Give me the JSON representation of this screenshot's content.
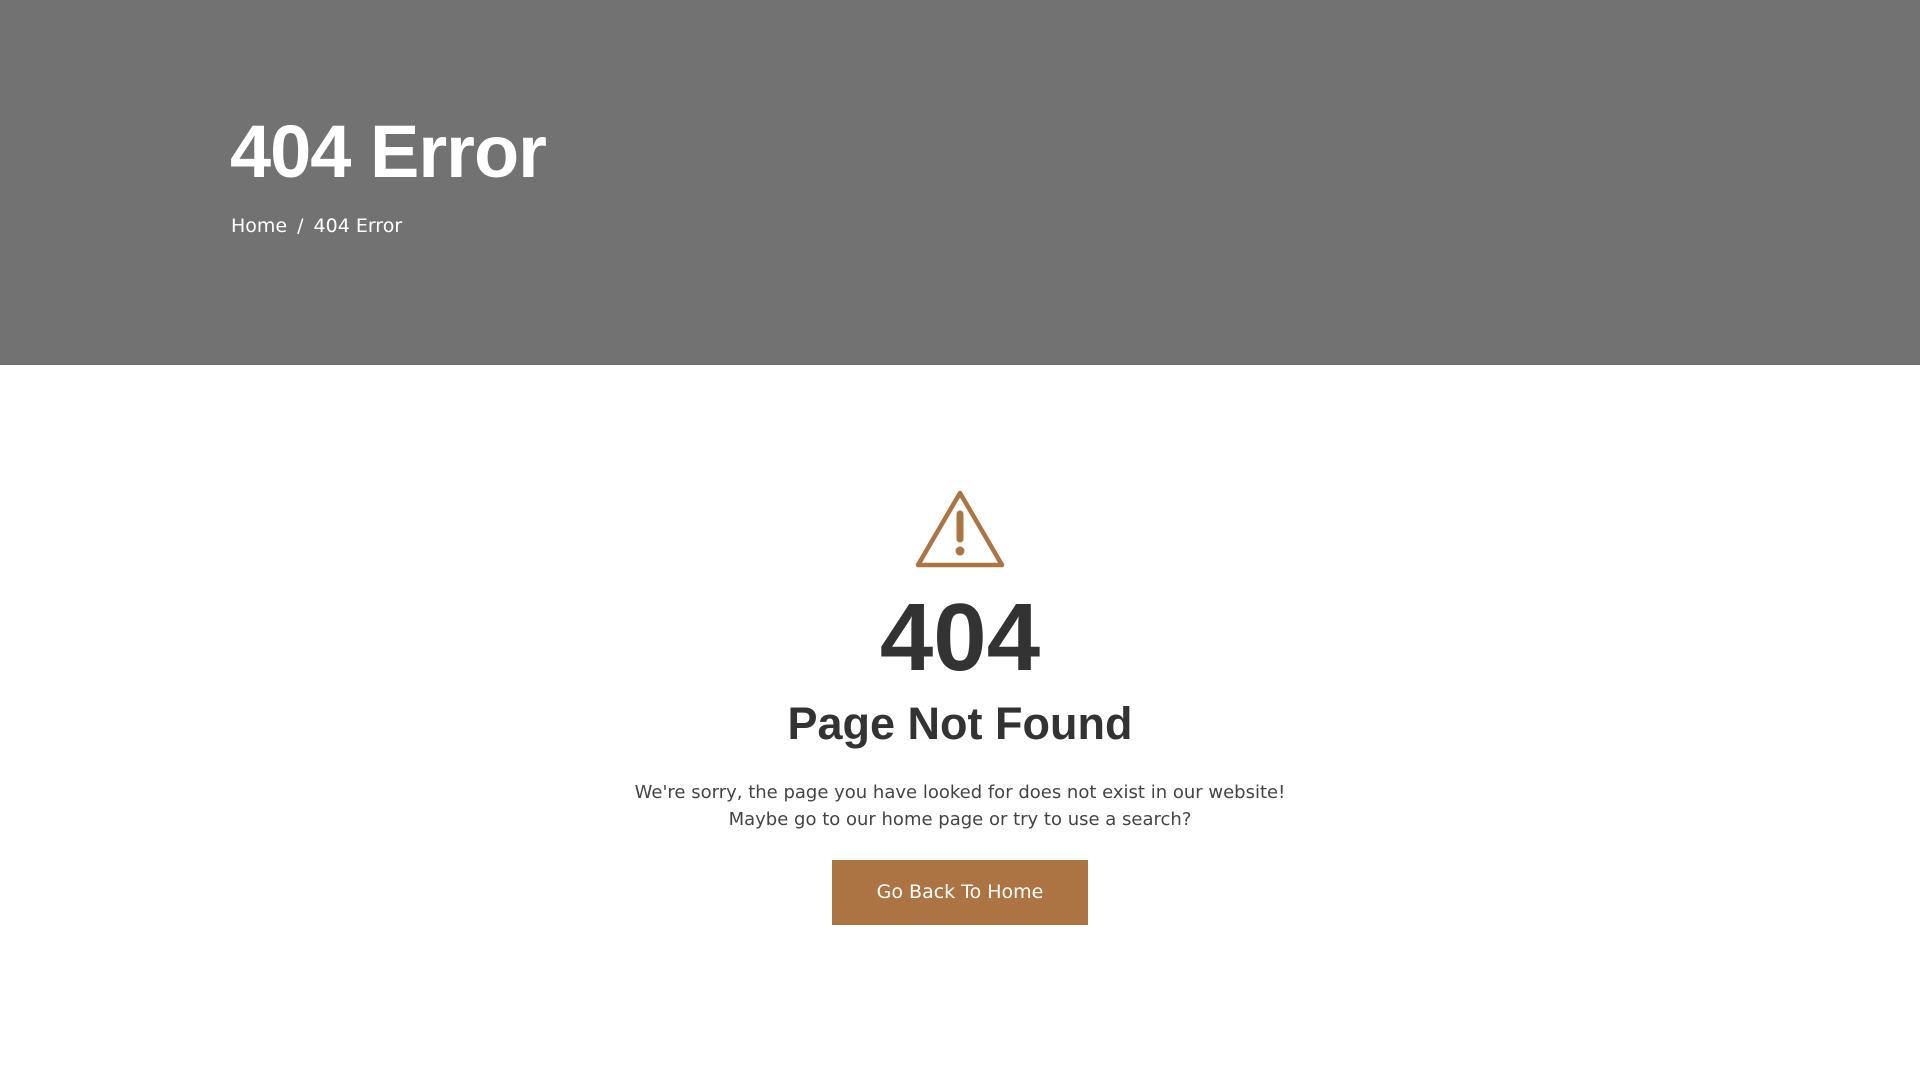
{
  "header": {
    "title": "404 Error",
    "breadcrumb": {
      "home": "Home",
      "separator": "/",
      "current": "404 Error"
    },
    "background_color": "#727272"
  },
  "main": {
    "icon": "warning-triangle-icon",
    "accent_color": "#ad7443",
    "code": "404",
    "heading": "Page Not Found",
    "message": "We're sorry, the page you have looked for does not exist in our website! Maybe go to our home page or try to use a search?",
    "button_label": "Go Back To Home"
  }
}
